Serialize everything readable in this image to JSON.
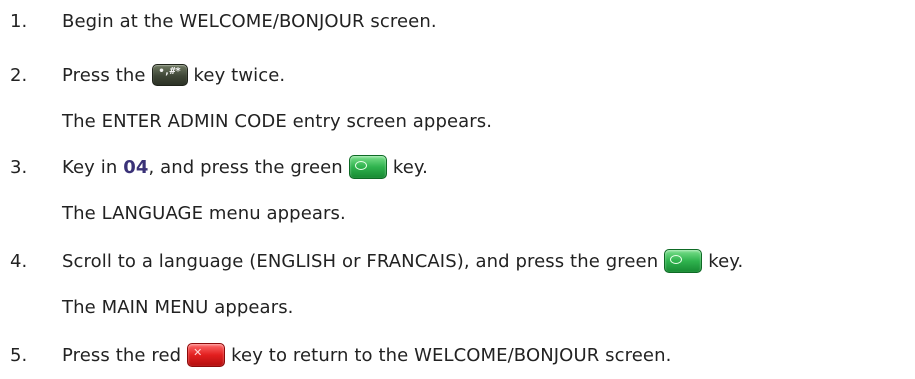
{
  "steps": [
    {
      "num": "1.",
      "text": "Begin at the WELCOME/BONJOUR screen."
    },
    {
      "num": "2.",
      "before": "Press the",
      "key_icon": "hash-key",
      "after": "key twice.",
      "result": "The ENTER ADMIN CODE entry screen appears."
    },
    {
      "num": "3.",
      "before": "Key in",
      "code": "04",
      "mid": ", and press the green",
      "key_icon": "green-key",
      "after": "key.",
      "result": "The LANGUAGE menu appears."
    },
    {
      "num": "4.",
      "before": "Scroll to a language (ENGLISH or FRANCAIS), and press the green",
      "key_icon": "green-key",
      "after": "key.",
      "result": "The MAIN MENU appears."
    },
    {
      "num": "5.",
      "before": "Press the red",
      "key_icon": "red-key",
      "after": "key to return to the WELCOME/BONJOUR screen."
    }
  ],
  "keys": {
    "hash_label": "•,#*",
    "green_color": "#2fb34e",
    "red_color": "#e21f1f",
    "hash_color": "#3f4737"
  },
  "colors": {
    "text": "#222222",
    "code": "#3a3278"
  }
}
